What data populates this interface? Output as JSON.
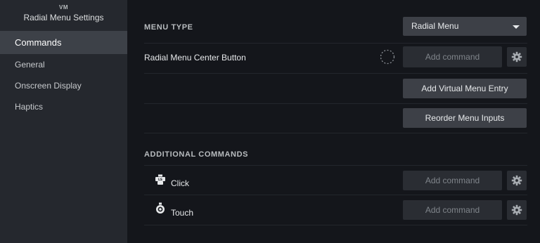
{
  "sidebar": {
    "abbr": "VM",
    "title": "Radial Menu Settings",
    "items": [
      {
        "label": "Commands",
        "active": true
      },
      {
        "label": "General"
      },
      {
        "label": "Onscreen Display"
      },
      {
        "label": "Haptics"
      }
    ]
  },
  "menu_type": {
    "title": "MENU TYPE",
    "selected": "Radial Menu"
  },
  "center_button": {
    "label": "Radial Menu Center Button",
    "command": "Add command"
  },
  "buttons": {
    "add_virtual": "Add Virtual Menu Entry",
    "reorder": "Reorder Menu Inputs"
  },
  "additional": {
    "title": "ADDITIONAL COMMANDS",
    "items": [
      {
        "label": "Click",
        "command": "Add command",
        "icon": "click-icon"
      },
      {
        "label": "Touch",
        "command": "Add command",
        "icon": "touch-icon"
      }
    ]
  }
}
